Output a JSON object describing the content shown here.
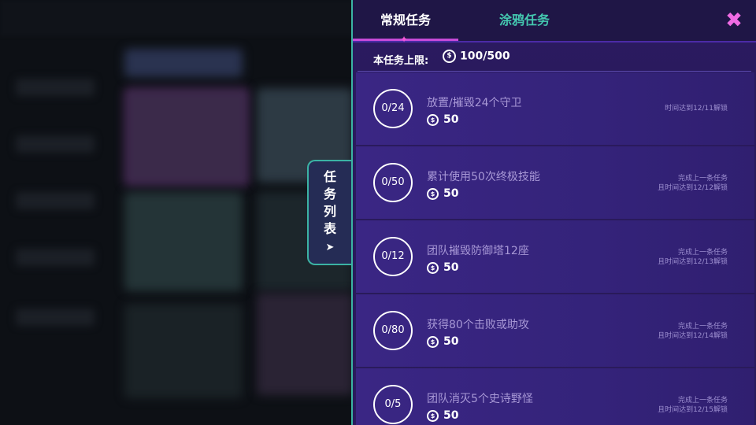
{
  "side_tab": {
    "chars": [
      "任",
      "务",
      "列",
      "表"
    ],
    "arrow_icon": "arrow-icon"
  },
  "panel": {
    "tabs": [
      {
        "label": "常规任务",
        "active": true
      },
      {
        "label": "涂鸦任务",
        "active": false
      }
    ],
    "close_icon": "close-icon",
    "limit": {
      "label": "本任务上限:",
      "coin_icon": "coin-icon",
      "value": "100/500"
    },
    "tasks": [
      {
        "progress": "0/24",
        "title": "放置/摧毁24个守卫",
        "reward": "50",
        "note_line1": "时间达到12/11解锁",
        "note_line2": ""
      },
      {
        "progress": "0/50",
        "title": "累计使用50次终极技能",
        "reward": "50",
        "note_line1": "完成上一条任务",
        "note_line2": "且时间达到12/12解锁"
      },
      {
        "progress": "0/12",
        "title": "团队摧毁防御塔12座",
        "reward": "50",
        "note_line1": "完成上一条任务",
        "note_line2": "且时间达到12/13解锁"
      },
      {
        "progress": "0/80",
        "title": "获得80个击败或助攻",
        "reward": "50",
        "note_line1": "完成上一条任务",
        "note_line2": "且时间达到12/14解锁"
      },
      {
        "progress": "0/5",
        "title": "团队消灭5个史诗野怪",
        "reward": "50",
        "note_line1": "完成上一条任务",
        "note_line2": "且时间达到12/15解锁"
      }
    ]
  },
  "colors": {
    "accent_teal": "#3bb3a4",
    "accent_pink": "#f06be5",
    "panel_bg": "#2b1a60"
  }
}
